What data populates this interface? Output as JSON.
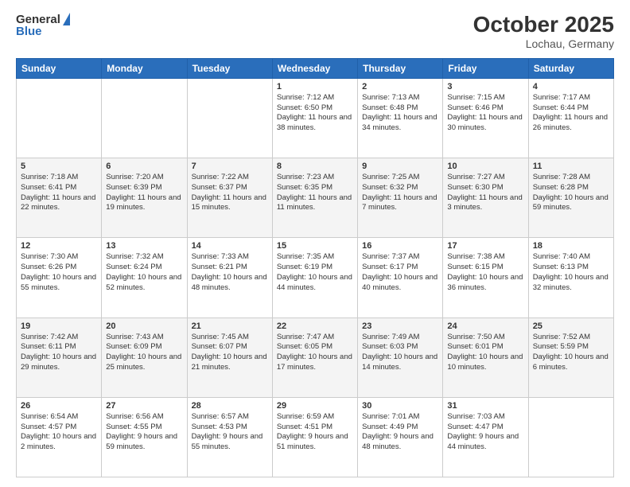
{
  "header": {
    "logo_general": "General",
    "logo_blue": "Blue",
    "month": "October 2025",
    "location": "Lochau, Germany"
  },
  "days_of_week": [
    "Sunday",
    "Monday",
    "Tuesday",
    "Wednesday",
    "Thursday",
    "Friday",
    "Saturday"
  ],
  "weeks": [
    [
      {
        "day": "",
        "info": ""
      },
      {
        "day": "",
        "info": ""
      },
      {
        "day": "",
        "info": ""
      },
      {
        "day": "1",
        "info": "Sunrise: 7:12 AM\nSunset: 6:50 PM\nDaylight: 11 hours and 38 minutes."
      },
      {
        "day": "2",
        "info": "Sunrise: 7:13 AM\nSunset: 6:48 PM\nDaylight: 11 hours and 34 minutes."
      },
      {
        "day": "3",
        "info": "Sunrise: 7:15 AM\nSunset: 6:46 PM\nDaylight: 11 hours and 30 minutes."
      },
      {
        "day": "4",
        "info": "Sunrise: 7:17 AM\nSunset: 6:44 PM\nDaylight: 11 hours and 26 minutes."
      }
    ],
    [
      {
        "day": "5",
        "info": "Sunrise: 7:18 AM\nSunset: 6:41 PM\nDaylight: 11 hours and 22 minutes."
      },
      {
        "day": "6",
        "info": "Sunrise: 7:20 AM\nSunset: 6:39 PM\nDaylight: 11 hours and 19 minutes."
      },
      {
        "day": "7",
        "info": "Sunrise: 7:22 AM\nSunset: 6:37 PM\nDaylight: 11 hours and 15 minutes."
      },
      {
        "day": "8",
        "info": "Sunrise: 7:23 AM\nSunset: 6:35 PM\nDaylight: 11 hours and 11 minutes."
      },
      {
        "day": "9",
        "info": "Sunrise: 7:25 AM\nSunset: 6:32 PM\nDaylight: 11 hours and 7 minutes."
      },
      {
        "day": "10",
        "info": "Sunrise: 7:27 AM\nSunset: 6:30 PM\nDaylight: 11 hours and 3 minutes."
      },
      {
        "day": "11",
        "info": "Sunrise: 7:28 AM\nSunset: 6:28 PM\nDaylight: 10 hours and 59 minutes."
      }
    ],
    [
      {
        "day": "12",
        "info": "Sunrise: 7:30 AM\nSunset: 6:26 PM\nDaylight: 10 hours and 55 minutes."
      },
      {
        "day": "13",
        "info": "Sunrise: 7:32 AM\nSunset: 6:24 PM\nDaylight: 10 hours and 52 minutes."
      },
      {
        "day": "14",
        "info": "Sunrise: 7:33 AM\nSunset: 6:21 PM\nDaylight: 10 hours and 48 minutes."
      },
      {
        "day": "15",
        "info": "Sunrise: 7:35 AM\nSunset: 6:19 PM\nDaylight: 10 hours and 44 minutes."
      },
      {
        "day": "16",
        "info": "Sunrise: 7:37 AM\nSunset: 6:17 PM\nDaylight: 10 hours and 40 minutes."
      },
      {
        "day": "17",
        "info": "Sunrise: 7:38 AM\nSunset: 6:15 PM\nDaylight: 10 hours and 36 minutes."
      },
      {
        "day": "18",
        "info": "Sunrise: 7:40 AM\nSunset: 6:13 PM\nDaylight: 10 hours and 32 minutes."
      }
    ],
    [
      {
        "day": "19",
        "info": "Sunrise: 7:42 AM\nSunset: 6:11 PM\nDaylight: 10 hours and 29 minutes."
      },
      {
        "day": "20",
        "info": "Sunrise: 7:43 AM\nSunset: 6:09 PM\nDaylight: 10 hours and 25 minutes."
      },
      {
        "day": "21",
        "info": "Sunrise: 7:45 AM\nSunset: 6:07 PM\nDaylight: 10 hours and 21 minutes."
      },
      {
        "day": "22",
        "info": "Sunrise: 7:47 AM\nSunset: 6:05 PM\nDaylight: 10 hours and 17 minutes."
      },
      {
        "day": "23",
        "info": "Sunrise: 7:49 AM\nSunset: 6:03 PM\nDaylight: 10 hours and 14 minutes."
      },
      {
        "day": "24",
        "info": "Sunrise: 7:50 AM\nSunset: 6:01 PM\nDaylight: 10 hours and 10 minutes."
      },
      {
        "day": "25",
        "info": "Sunrise: 7:52 AM\nSunset: 5:59 PM\nDaylight: 10 hours and 6 minutes."
      }
    ],
    [
      {
        "day": "26",
        "info": "Sunrise: 6:54 AM\nSunset: 4:57 PM\nDaylight: 10 hours and 2 minutes."
      },
      {
        "day": "27",
        "info": "Sunrise: 6:56 AM\nSunset: 4:55 PM\nDaylight: 9 hours and 59 minutes."
      },
      {
        "day": "28",
        "info": "Sunrise: 6:57 AM\nSunset: 4:53 PM\nDaylight: 9 hours and 55 minutes."
      },
      {
        "day": "29",
        "info": "Sunrise: 6:59 AM\nSunset: 4:51 PM\nDaylight: 9 hours and 51 minutes."
      },
      {
        "day": "30",
        "info": "Sunrise: 7:01 AM\nSunset: 4:49 PM\nDaylight: 9 hours and 48 minutes."
      },
      {
        "day": "31",
        "info": "Sunrise: 7:03 AM\nSunset: 4:47 PM\nDaylight: 9 hours and 44 minutes."
      },
      {
        "day": "",
        "info": ""
      }
    ]
  ]
}
